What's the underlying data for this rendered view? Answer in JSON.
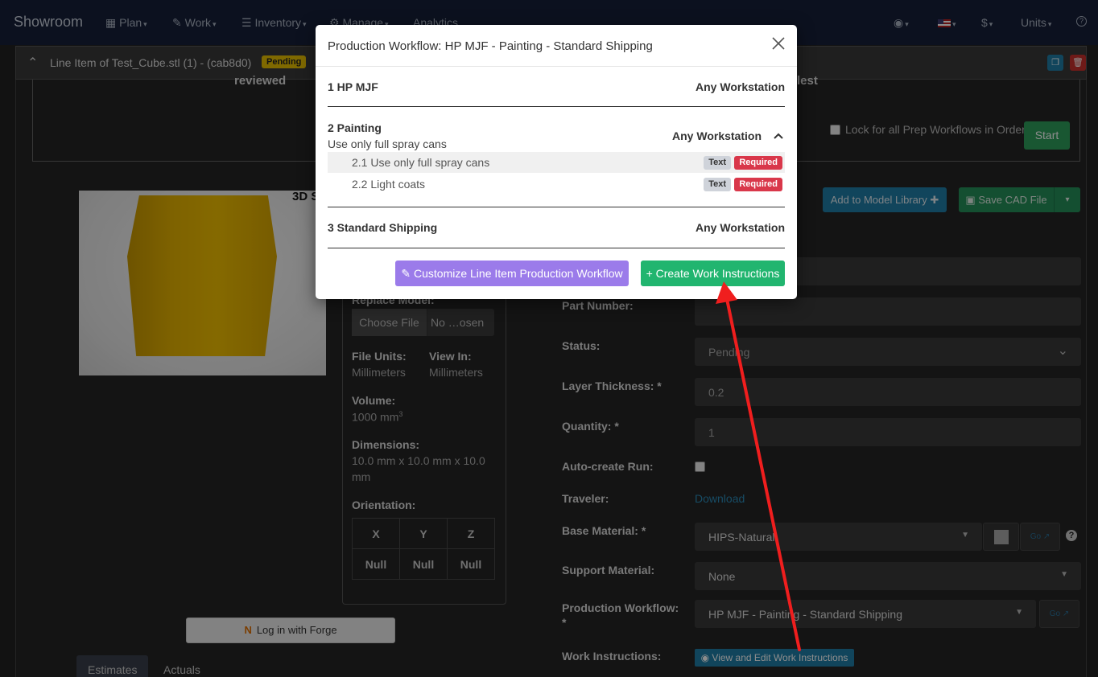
{
  "navbar": {
    "brand": "Showroom",
    "items": [
      {
        "label": "Plan",
        "icon": "calendar-icon"
      },
      {
        "label": "Work",
        "icon": "wrench-icon"
      },
      {
        "label": "Inventory",
        "icon": "list-icon"
      },
      {
        "label": "Manage",
        "icon": "gear-icon"
      },
      {
        "label": "Analytics",
        "icon": ""
      }
    ],
    "currency": "$",
    "units": "Units"
  },
  "panel": {
    "title": "Line Item of Test_Cube.stl (1) - (cab8d0)",
    "status_badge": "Pending"
  },
  "prep": {
    "left_title": "reviewed",
    "right_title": "lest",
    "lock_label": "Lock for all Prep Workflows in Order",
    "start_label": "Start"
  },
  "model": {
    "label_3d": "3D S",
    "replace_label": "Replace Model:",
    "choose_file": "Choose File",
    "file_name": "No …osen",
    "file_units_label": "File Units:",
    "file_units_value": "Millimeters",
    "view_in_label": "View In:",
    "view_in_value": "Millimeters",
    "volume_label": "Volume:",
    "volume_value": "1000 mm",
    "volume_sup": "3",
    "dimensions_label": "Dimensions:",
    "dimensions_value_1": "10.0 mm x 10.0 mm x 10.0",
    "dimensions_value_2": "mm",
    "orientation_label": "Orientation:",
    "orientation_headers": [
      "X",
      "Y",
      "Z"
    ],
    "orientation_values": [
      "Null",
      "Null",
      "Null"
    ]
  },
  "forge_button": "Log in with Forge",
  "tabs": [
    "Estimates",
    "Actuals"
  ],
  "actions": {
    "add_library": "Add to Model Library",
    "save_cad": "Save CAD File"
  },
  "form": {
    "part_number_label": "Part Number:",
    "status_label": "Status:",
    "status_value": "Pending",
    "layer_label": "Layer Thickness: *",
    "layer_value": "0.2",
    "quantity_label": "Quantity: *",
    "quantity_value": "1",
    "autocreate_label": "Auto-create Run:",
    "traveler_label": "Traveler:",
    "traveler_link": "Download",
    "base_material_label": "Base Material: *",
    "base_material_value": "HIPS-Natural",
    "support_label": "Support Material:",
    "support_value": "None",
    "workflow_label_1": "Production Workflow:",
    "workflow_label_2": "*",
    "workflow_value": "HP MJF - Painting - Standard Shipping",
    "work_instr_label": "Work Instructions:",
    "work_instr_button": "View and Edit Work Instructions",
    "go_label": "Go"
  },
  "modal": {
    "title": "Production Workflow: HP MJF - Painting - Standard Shipping",
    "steps": [
      {
        "name": "1 HP MJF",
        "workstation": "Any Workstation"
      },
      {
        "name": "2 Painting",
        "workstation": "Any Workstation",
        "description": "Use only full spray cans"
      },
      {
        "name": "3 Standard Shipping",
        "workstation": "Any Workstation"
      }
    ],
    "substeps": [
      {
        "name": "2.1 Use only full spray cans",
        "type": "Text",
        "required": "Required"
      },
      {
        "name": "2.2 Light coats",
        "type": "Text",
        "required": "Required"
      }
    ],
    "customize_button": "Customize Line Item Production Workflow",
    "create_button": "+ Create Work Instructions"
  },
  "colors": {
    "navbar": "#16203a",
    "accent_green": "#21b56f",
    "accent_purple": "#9b7bea",
    "required_red": "#d9374a",
    "annotation_arrow": "#f01e1e"
  }
}
